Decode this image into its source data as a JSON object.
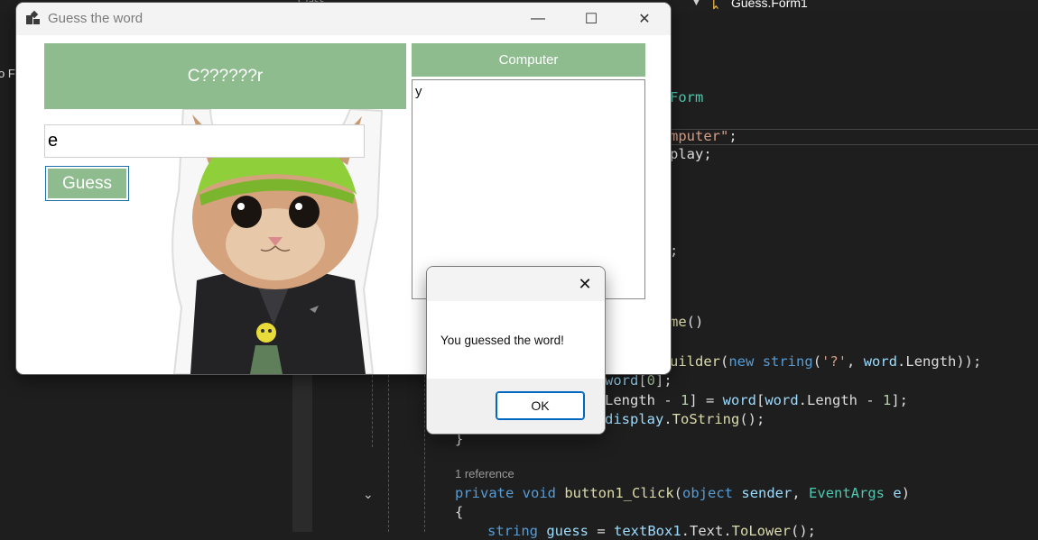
{
  "ide": {
    "class_label": "Guess.Form1",
    "tab_fragment": "Class",
    "left_fragment": "o Fr",
    "codelens": "1 reference"
  },
  "window": {
    "title": "Guess the word",
    "minimize_glyph": "—",
    "maximize_glyph": "☐",
    "close_glyph": "✕"
  },
  "game": {
    "word_display": "C??????r",
    "computer_label": "Computer",
    "guessed_letters": [
      "y"
    ],
    "guess_input_value": "e",
    "guess_button_label": "Guess",
    "accent_color": "#8fbc8f"
  },
  "message_box": {
    "close_glyph": "✕",
    "message": "You guessed the word!",
    "ok_label": "OK"
  }
}
